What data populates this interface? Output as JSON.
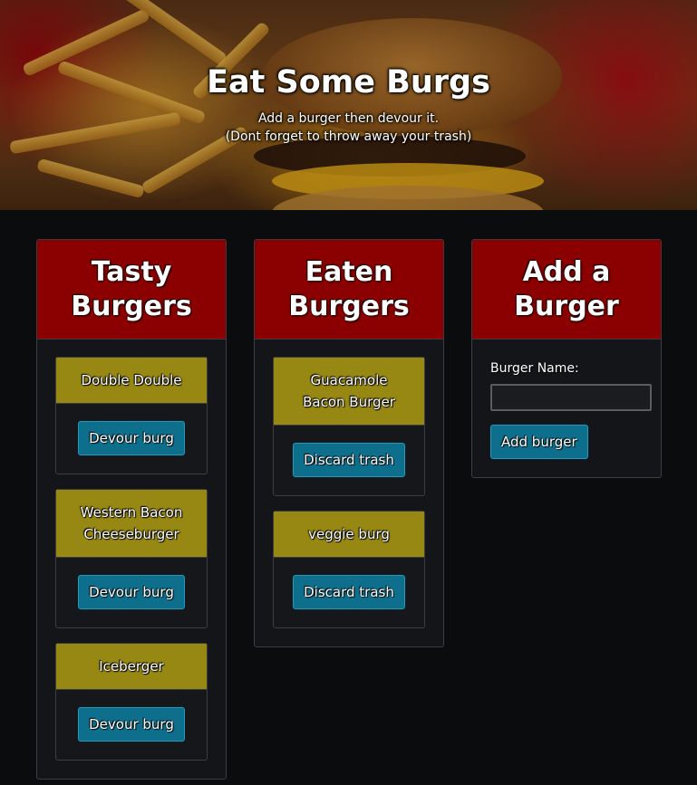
{
  "hero": {
    "title": "Eat Some Burgs",
    "subtitle_line1": "Add a burger then devour it.",
    "subtitle_line2": "(Dont forget to throw away your trash)"
  },
  "tasty": {
    "heading": "Tasty Burgers",
    "button_label": "Devour burg",
    "burgers": [
      "Double Double",
      "Western Bacon Cheeseburger",
      "Iceberger"
    ]
  },
  "eaten": {
    "heading": "Eaten Burgers",
    "button_label": "Discard trash",
    "burgers": [
      "Guacamole Bacon Burger",
      "veggie burg"
    ]
  },
  "add": {
    "heading": "Add a Burger",
    "field_label": "Burger Name:",
    "field_value": "",
    "button_label": "Add burger"
  },
  "colors": {
    "panel_header": "#8b0000",
    "card_header": "#978813",
    "button": "#0e6f8c",
    "background": "#0b0c0e"
  }
}
